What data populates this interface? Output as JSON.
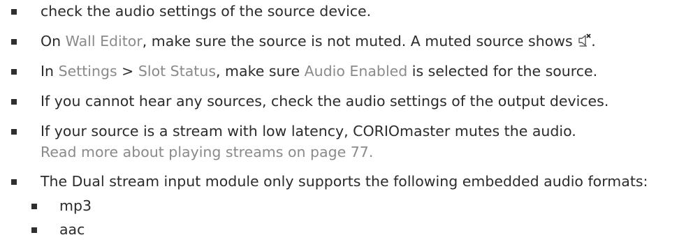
{
  "items": [
    {
      "text": "check the audio settings of the source device."
    },
    {
      "prefix": "On ",
      "link": "Wall Editor",
      "suffix": ", make sure the source is not muted. A muted source shows",
      "end": ".",
      "icon": "muted-speaker-icon"
    },
    {
      "prefix": "In ",
      "link1": "Settings",
      "sep": " > ",
      "link2": "Slot Status",
      "mid": ", make sure ",
      "link3": "Audio Enabled",
      "suffix": " is selected for the source."
    },
    {
      "text": "If you cannot hear any sources, check the audio settings of the output devices."
    },
    {
      "text": "If your source is a stream with low latency, CORIOmaster mutes the audio.",
      "link": "Read more about playing streams on page 77."
    },
    {
      "text": "The Dual stream input module only supports the following embedded audio formats:",
      "subitems": [
        "mp3",
        "aac"
      ]
    }
  ],
  "colors": {
    "text": "#2b2b2b",
    "link": "#8a8a8a",
    "bullet": "#2f2f2f"
  }
}
